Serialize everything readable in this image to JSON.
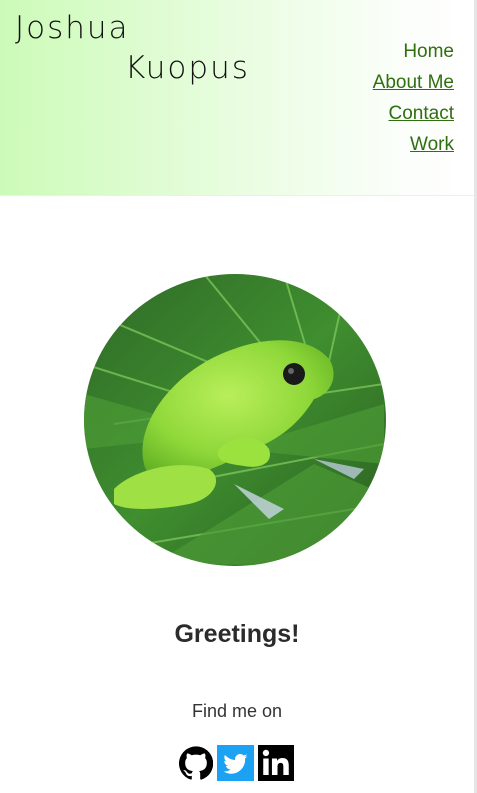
{
  "header": {
    "first_name": "Joshua",
    "last_name": "Kuopus",
    "nav": [
      {
        "label": "Home"
      },
      {
        "label": "About Me"
      },
      {
        "label": "Contact"
      },
      {
        "label": "Work"
      }
    ]
  },
  "main": {
    "avatar_alt": "green tree frog on palm leaf",
    "greeting": "Greetings!",
    "find_me": "Find me on",
    "social": [
      {
        "icon": "github-icon"
      },
      {
        "icon": "twitter-icon"
      },
      {
        "icon": "linkedin-icon"
      }
    ]
  },
  "colors": {
    "header_gradient_start": "#ccfbb8",
    "nav_link": "#2f6f10",
    "twitter": "#1da1f2"
  }
}
